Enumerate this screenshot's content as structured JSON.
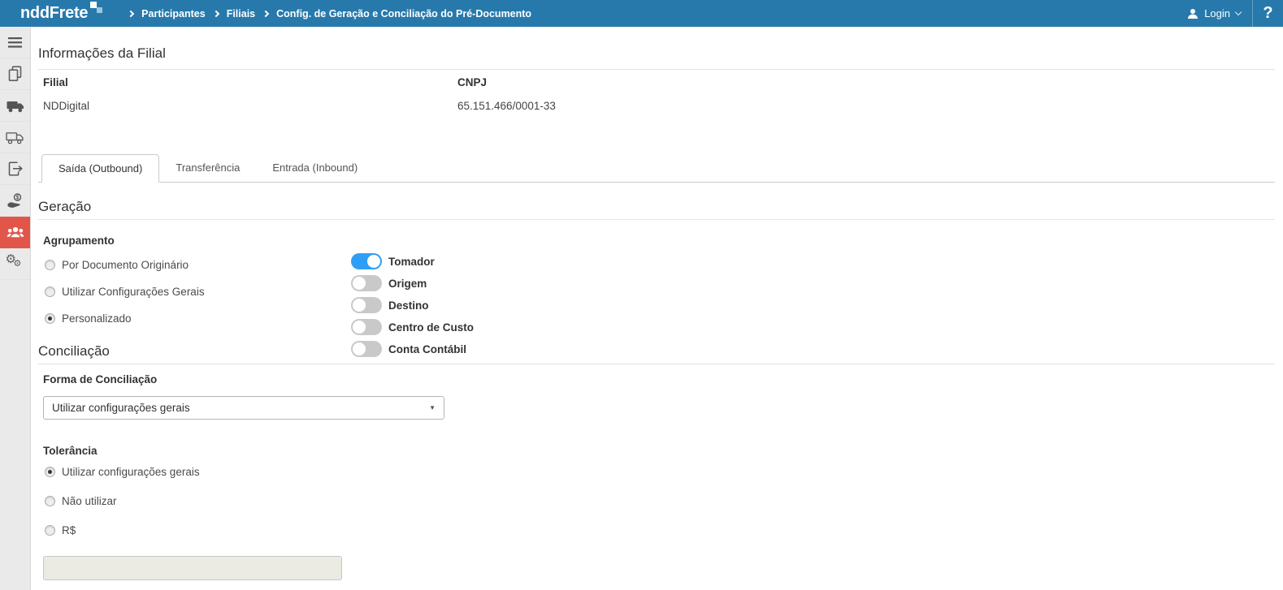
{
  "topbar": {
    "logo_text": "nddFrete",
    "breadcrumbs": [
      "Participantes",
      "Filiais",
      "Config. de Geração e Conciliação do Pré-Documento"
    ],
    "login_label": "Login",
    "help_label": "?"
  },
  "sidebar": {
    "items": [
      {
        "icon": "hamburger-menu-icon",
        "active": false
      },
      {
        "icon": "documents-copy-icon",
        "active": false
      },
      {
        "icon": "truck-filled-icon",
        "active": false
      },
      {
        "icon": "truck-outline-icon",
        "active": false
      },
      {
        "icon": "document-export-icon",
        "active": false
      },
      {
        "icon": "payment-hand-coin-icon",
        "active": false
      },
      {
        "icon": "participants-people-icon",
        "active": true
      },
      {
        "icon": "settings-gears-icon",
        "active": false
      }
    ]
  },
  "branch_info": {
    "title": "Informações da Filial",
    "fields": [
      {
        "label": "Filial",
        "value": "NDDigital"
      },
      {
        "label": "CNPJ",
        "value": "65.151.466/0001-33"
      }
    ]
  },
  "tabs": [
    {
      "label": "Saída (Outbound)",
      "active": true
    },
    {
      "label": "Transferência",
      "active": false
    },
    {
      "label": "Entrada (Inbound)",
      "active": false
    }
  ],
  "generation": {
    "title": "Geração",
    "grouping": {
      "label": "Agrupamento",
      "radios": [
        {
          "label": "Por Documento Originário",
          "selected": false
        },
        {
          "label": "Utilizar Configurações Gerais",
          "selected": false
        },
        {
          "label": "Personalizado",
          "selected": true
        }
      ],
      "toggles": [
        {
          "label": "Tomador",
          "on": true
        },
        {
          "label": "Origem",
          "on": false
        },
        {
          "label": "Destino",
          "on": false
        },
        {
          "label": "Centro de Custo",
          "on": false
        },
        {
          "label": "Conta Contábil",
          "on": false
        }
      ]
    }
  },
  "conciliation": {
    "title": "Conciliação",
    "form_label": "Forma de Conciliação",
    "select_value": "Utilizar configurações gerais"
  },
  "tolerance": {
    "label": "Tolerância",
    "radios": [
      {
        "label": "Utilizar configurações gerais",
        "selected": true
      },
      {
        "label": "Não utilizar",
        "selected": false
      },
      {
        "label": "R$",
        "selected": false
      }
    ],
    "input_value": ""
  },
  "colors": {
    "topbar_blue": "#2779ab",
    "active_item_red": "#e2564a",
    "toggle_on_blue": "#2f9ff6"
  }
}
